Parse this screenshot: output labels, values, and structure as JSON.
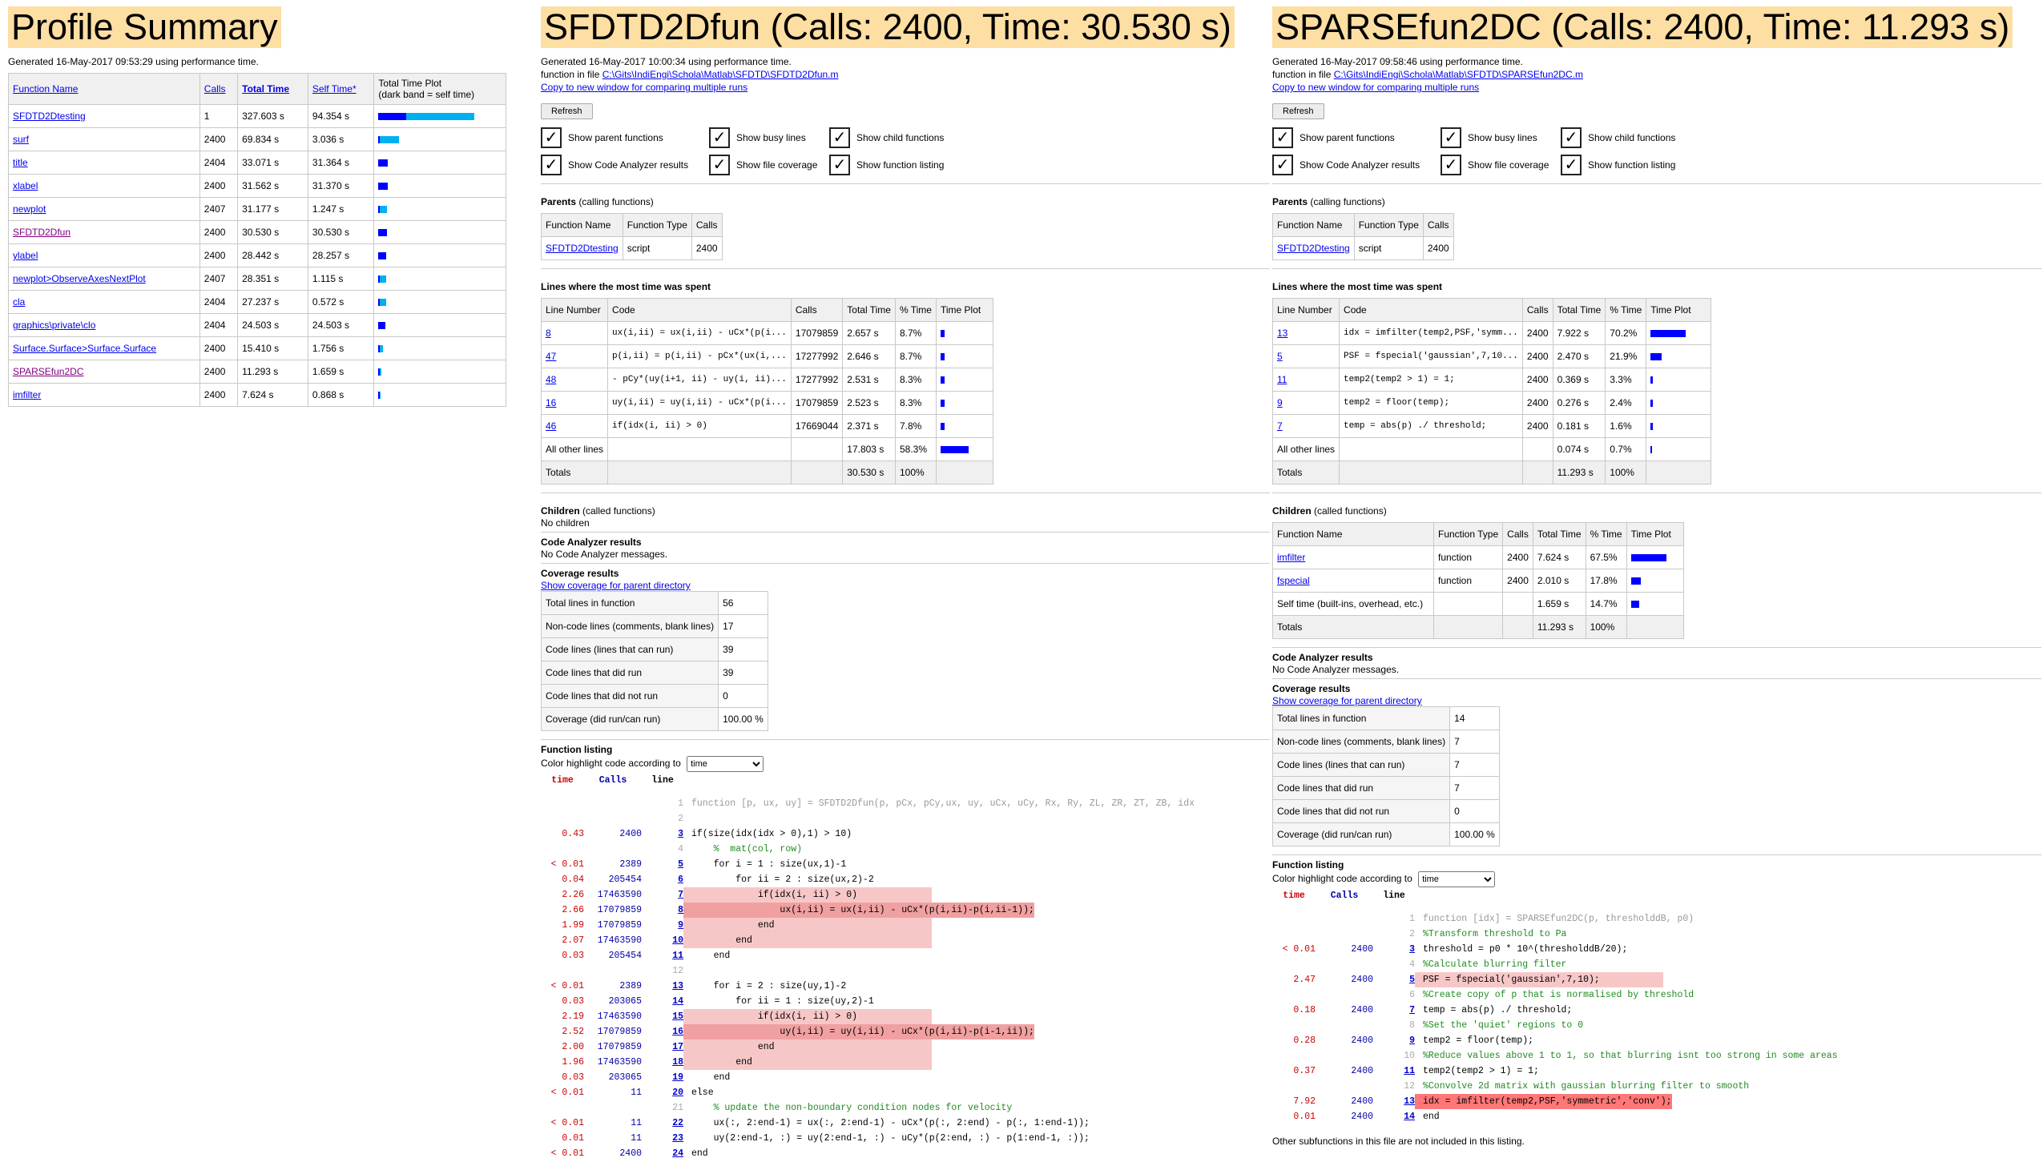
{
  "summary": {
    "title": "Profile Summary",
    "generated": "Generated 16-May-2017 09:53:29 using performance time.",
    "columns": [
      "Function Name",
      "Calls",
      "Total Time",
      "Self Time*",
      "Total Time Plot",
      "(dark band = self time)"
    ],
    "rows": [
      {
        "name": "SFDTD2Dtesting",
        "calls": "1",
        "total": "327.603 s",
        "self": "94.354 s",
        "total_frac": 1.0,
        "self_frac": 0.288,
        "visited": false
      },
      {
        "name": "surf",
        "calls": "2400",
        "total": "69.834 s",
        "self": "3.036 s",
        "total_frac": 0.213,
        "self_frac": 0.009,
        "visited": false
      },
      {
        "name": "title",
        "calls": "2404",
        "total": "33.071 s",
        "self": "31.364 s",
        "total_frac": 0.101,
        "self_frac": 0.096,
        "visited": false
      },
      {
        "name": "xlabel",
        "calls": "2400",
        "total": "31.562 s",
        "self": "31.370 s",
        "total_frac": 0.096,
        "self_frac": 0.096,
        "visited": false
      },
      {
        "name": "newplot",
        "calls": "2407",
        "total": "31.177 s",
        "self": "1.247 s",
        "total_frac": 0.095,
        "self_frac": 0.004,
        "visited": false
      },
      {
        "name": "SFDTD2Dfun",
        "calls": "2400",
        "total": "30.530 s",
        "self": "30.530 s",
        "total_frac": 0.093,
        "self_frac": 0.093,
        "visited": true
      },
      {
        "name": "ylabel",
        "calls": "2400",
        "total": "28.442 s",
        "self": "28.257 s",
        "total_frac": 0.087,
        "self_frac": 0.086,
        "visited": false
      },
      {
        "name": "newplot>ObserveAxesNextPlot",
        "calls": "2407",
        "total": "28.351 s",
        "self": "1.115 s",
        "total_frac": 0.087,
        "self_frac": 0.003,
        "visited": false
      },
      {
        "name": "cla",
        "calls": "2404",
        "total": "27.237 s",
        "self": "0.572 s",
        "total_frac": 0.083,
        "self_frac": 0.002,
        "visited": false
      },
      {
        "name": "graphics\\private\\clo",
        "calls": "2404",
        "total": "24.503 s",
        "self": "24.503 s",
        "total_frac": 0.075,
        "self_frac": 0.075,
        "visited": false
      },
      {
        "name": "Surface.Surface>Surface.Surface",
        "calls": "2400",
        "total": "15.410 s",
        "self": "1.756 s",
        "total_frac": 0.047,
        "self_frac": 0.005,
        "visited": false
      },
      {
        "name": "SPARSEfun2DC",
        "calls": "2400",
        "total": "11.293 s",
        "self": "1.659 s",
        "total_frac": 0.034,
        "self_frac": 0.005,
        "visited": true
      },
      {
        "name": "imfilter",
        "calls": "2400",
        "total": "7.624 s",
        "self": "0.868 s",
        "total_frac": 0.023,
        "self_frac": 0.003,
        "visited": false
      }
    ]
  },
  "common": {
    "refresh": "Refresh",
    "checks": [
      "Show parent functions",
      "Show busy lines",
      "Show child functions",
      "Show Code Analyzer results",
      "Show file coverage",
      "Show function listing"
    ],
    "parents_label": "Parents",
    "parents_sub": "(calling functions)",
    "parents_cols": [
      "Function Name",
      "Function Type",
      "Calls"
    ],
    "lines_label": "Lines where the most time was spent",
    "lines_cols": [
      "Line Number",
      "Code",
      "Calls",
      "Total Time",
      "% Time",
      "Time Plot"
    ],
    "children_label": "Children",
    "children_sub": "(called functions)",
    "ca_label": "Code Analyzer results",
    "ca_msg": "No Code Analyzer messages.",
    "cov_label": "Coverage results",
    "cov_link": "Show coverage for parent directory",
    "cov_rows": [
      "Total lines in function",
      "Non-code lines (comments, blank lines)",
      "Code lines (lines that can run)",
      "Code lines that did run",
      "Code lines that did not run",
      "Coverage (did run/can run)"
    ],
    "listing_label": "Function listing",
    "color_by": "Color highlight code according to",
    "color_opt": "time",
    "lhead": [
      "time",
      "Calls",
      "line"
    ],
    "copy_link": "Copy to new window for comparing multiple runs",
    "fn_in_file": "function in file"
  },
  "fun1": {
    "title": "SFDTD2Dfun (Calls: 2400, Time: 30.530 s)",
    "generated": "Generated 16-May-2017 10:00:34 using performance time.",
    "file": "C:\\Gits\\IndiEngi\\Schola\\Matlab\\SFDTD\\SFDTD2Dfun.m",
    "parents": [
      {
        "name": "SFDTD2Dtesting",
        "type": "script",
        "calls": "2400"
      }
    ],
    "lines": [
      {
        "ln": "8",
        "code": "ux(i,ii) = ux(i,ii) - uCx*(p(i...",
        "calls": "17079859",
        "time": "2.657 s",
        "pct": "8.7%",
        "frac": 0.087
      },
      {
        "ln": "47",
        "code": "p(i,ii) = p(i,ii) - pCx*(ux(i,...",
        "calls": "17277992",
        "time": "2.646 s",
        "pct": "8.7%",
        "frac": 0.087
      },
      {
        "ln": "48",
        "code": "- pCy*(uy(i+1, ii) - uy(i, ii)...",
        "calls": "17277992",
        "time": "2.531 s",
        "pct": "8.3%",
        "frac": 0.083
      },
      {
        "ln": "16",
        "code": "uy(i,ii) = uy(i,ii) - uCx*(p(i...",
        "calls": "17079859",
        "time": "2.523 s",
        "pct": "8.3%",
        "frac": 0.083
      },
      {
        "ln": "46",
        "code": "if(idx(i, ii) > 0)",
        "calls": "17669044",
        "time": "2.371 s",
        "pct": "7.8%",
        "frac": 0.078
      }
    ],
    "other": {
      "label": "All other lines",
      "time": "17.803 s",
      "pct": "58.3%",
      "frac": 0.583
    },
    "totals": {
      "label": "Totals",
      "time": "30.530 s",
      "pct": "100%"
    },
    "no_children": "No children",
    "coverage": [
      "56",
      "17",
      "39",
      "39",
      "0",
      "100.00 %"
    ],
    "listing": [
      {
        "t": "",
        "c": "",
        "ln": "1",
        "code": "function [p, ux, uy] = SFDTD2Dfun(p, pCx, pCy,ux, uy, uCx, uCy, Rx, Ry, ZL, ZR, ZT, ZB, idx",
        "cls": "gray",
        "hl": "",
        "gl": true
      },
      {
        "t": "",
        "c": "",
        "ln": "2",
        "code": "",
        "cls": "",
        "hl": "",
        "gl": true
      },
      {
        "t": "0.43",
        "c": "2400",
        "ln": "3",
        "code": "if(size(idx(idx > 0),1) > 10)",
        "cls": "",
        "hl": "",
        "gl": false
      },
      {
        "t": "",
        "c": "",
        "ln": "4",
        "code": "    %  mat(col, row)",
        "cls": "cmt",
        "hl": "",
        "gl": true
      },
      {
        "t": "< 0.01",
        "c": "2389",
        "ln": "5",
        "code": "    for i = 1 : size(ux,1)-1",
        "cls": "",
        "hl": "",
        "gl": false
      },
      {
        "t": "0.04",
        "c": "205454",
        "ln": "6",
        "code": "        for ii = 2 : size(ux,2)-2",
        "cls": "",
        "hl": "",
        "gl": false
      },
      {
        "t": "2.26",
        "c": "17463590",
        "ln": "7",
        "code": "            if(idx(i, ii) > 0)",
        "cls": "",
        "hl": "hl",
        "gl": false
      },
      {
        "t": "2.66",
        "c": "17079859",
        "ln": "8",
        "code": "                ux(i,ii) = ux(i,ii) - uCx*(p(i,ii)-p(i,ii-1));",
        "cls": "",
        "hl": "hl2",
        "gl": false
      },
      {
        "t": "1.99",
        "c": "17079859",
        "ln": "9",
        "code": "            end",
        "cls": "",
        "hl": "hl",
        "gl": false
      },
      {
        "t": "2.07",
        "c": "17463590",
        "ln": "10",
        "code": "        end",
        "cls": "",
        "hl": "hl",
        "gl": false
      },
      {
        "t": "0.03",
        "c": "205454",
        "ln": "11",
        "code": "    end",
        "cls": "",
        "hl": "",
        "gl": false
      },
      {
        "t": "",
        "c": "",
        "ln": "12",
        "code": "",
        "cls": "",
        "hl": "",
        "gl": true
      },
      {
        "t": "< 0.01",
        "c": "2389",
        "ln": "13",
        "code": "    for i = 2 : size(uy,1)-2",
        "cls": "",
        "hl": "",
        "gl": false
      },
      {
        "t": "0.03",
        "c": "203065",
        "ln": "14",
        "code": "        for ii = 1 : size(uy,2)-1",
        "cls": "",
        "hl": "",
        "gl": false
      },
      {
        "t": "2.19",
        "c": "17463590",
        "ln": "15",
        "code": "            if(idx(i, ii) > 0)",
        "cls": "",
        "hl": "hl",
        "gl": false
      },
      {
        "t": "2.52",
        "c": "17079859",
        "ln": "16",
        "code": "                uy(i,ii) = uy(i,ii) - uCx*(p(i,ii)-p(i-1,ii));",
        "cls": "",
        "hl": "hl2",
        "gl": false
      },
      {
        "t": "2.00",
        "c": "17079859",
        "ln": "17",
        "code": "            end",
        "cls": "",
        "hl": "hl",
        "gl": false
      },
      {
        "t": "1.96",
        "c": "17463590",
        "ln": "18",
        "code": "        end",
        "cls": "",
        "hl": "hl",
        "gl": false
      },
      {
        "t": "0.03",
        "c": "203065",
        "ln": "19",
        "code": "    end",
        "cls": "",
        "hl": "",
        "gl": false
      },
      {
        "t": "< 0.01",
        "c": "11",
        "ln": "20",
        "code": "else",
        "cls": "",
        "hl": "",
        "gl": false
      },
      {
        "t": "",
        "c": "",
        "ln": "21",
        "code": "    % update the non-boundary condition nodes for velocity",
        "cls": "cmt",
        "hl": "",
        "gl": true
      },
      {
        "t": "< 0.01",
        "c": "11",
        "ln": "22",
        "code": "    ux(:, 2:end-1) = ux(:, 2:end-1) - uCx*(p(:, 2:end) - p(:, 1:end-1));",
        "cls": "",
        "hl": "",
        "gl": false
      },
      {
        "t": "0.01",
        "c": "11",
        "ln": "23",
        "code": "    uy(2:end-1, :) = uy(2:end-1, :) - uCy*(p(2:end, :) - p(1:end-1, :));",
        "cls": "",
        "hl": "",
        "gl": false
      },
      {
        "t": "< 0.01",
        "c": "2400",
        "ln": "24",
        "code": "end",
        "cls": "",
        "hl": "",
        "gl": false
      },
      {
        "t": "",
        "c": "",
        "ln": "25",
        "code": "",
        "cls": "",
        "hl": "",
        "gl": true
      }
    ]
  },
  "fun2": {
    "title": "SPARSEfun2DC (Calls: 2400, Time: 11.293 s)",
    "generated": "Generated 16-May-2017 09:58:46 using performance time.",
    "file": "C:\\Gits\\IndiEngi\\Schola\\Matlab\\SFDTD\\SPARSEfun2DC.m",
    "parents": [
      {
        "name": "SFDTD2Dtesting",
        "type": "script",
        "calls": "2400"
      }
    ],
    "lines": [
      {
        "ln": "13",
        "code": "idx = imfilter(temp2,PSF,'symm...",
        "calls": "2400",
        "time": "7.922 s",
        "pct": "70.2%",
        "frac": 0.702
      },
      {
        "ln": "5",
        "code": "PSF = fspecial('gaussian',7,10...",
        "calls": "2400",
        "time": "2.470 s",
        "pct": "21.9%",
        "frac": 0.219
      },
      {
        "ln": "11",
        "code": "temp2(temp2 > 1) = 1;",
        "calls": "2400",
        "time": "0.369 s",
        "pct": "3.3%",
        "frac": 0.033
      },
      {
        "ln": "9",
        "code": "temp2 = floor(temp);",
        "calls": "2400",
        "time": "0.276 s",
        "pct": "2.4%",
        "frac": 0.024
      },
      {
        "ln": "7",
        "code": "temp = abs(p) ./ threshold;",
        "calls": "2400",
        "time": "0.181 s",
        "pct": "1.6%",
        "frac": 0.016
      }
    ],
    "other": {
      "label": "All other lines",
      "time": "0.074 s",
      "pct": "0.7%",
      "frac": 0.007
    },
    "totals": {
      "label": "Totals",
      "time": "11.293 s",
      "pct": "100%"
    },
    "children_cols": [
      "Function Name",
      "Function Type",
      "Calls",
      "Total Time",
      "% Time",
      "Time Plot"
    ],
    "children": [
      {
        "name": "imfilter",
        "type": "function",
        "calls": "2400",
        "time": "7.624 s",
        "pct": "67.5%",
        "frac": 0.675,
        "link": true
      },
      {
        "name": "fspecial",
        "type": "function",
        "calls": "2400",
        "time": "2.010 s",
        "pct": "17.8%",
        "frac": 0.178,
        "link": true
      },
      {
        "name": "Self time (built-ins, overhead, etc.)",
        "type": "",
        "calls": "",
        "time": "1.659 s",
        "pct": "14.7%",
        "frac": 0.147,
        "link": false
      },
      {
        "name": "Totals",
        "type": "",
        "calls": "",
        "time": "11.293 s",
        "pct": "100%",
        "frac": 0,
        "link": false
      }
    ],
    "coverage": [
      "14",
      "7",
      "7",
      "7",
      "0",
      "100.00 %"
    ],
    "listing": [
      {
        "t": "",
        "c": "",
        "ln": "1",
        "code": "function [idx] = SPARSEfun2DC(p, thresholddB, p0)",
        "cls": "gray",
        "hl": "",
        "gl": true
      },
      {
        "t": "",
        "c": "",
        "ln": "2",
        "code": "%Transform threshold to Pa",
        "cls": "cmt",
        "hl": "",
        "gl": true
      },
      {
        "t": "< 0.01",
        "c": "2400",
        "ln": "3",
        "code": "threshold = p0 * 10^(thresholddB/20);",
        "cls": "",
        "hl": "",
        "gl": false
      },
      {
        "t": "",
        "c": "",
        "ln": "4",
        "code": "%Calculate blurring filter",
        "cls": "cmt",
        "hl": "",
        "gl": true
      },
      {
        "t": "2.47",
        "c": "2400",
        "ln": "5",
        "code": "PSF = fspecial('gaussian',7,10);",
        "cls": "",
        "hl": "hl",
        "gl": false
      },
      {
        "t": "",
        "c": "",
        "ln": "6",
        "code": "%Create copy of p that is normalised by threshold",
        "cls": "cmt",
        "hl": "",
        "gl": true
      },
      {
        "t": "0.18",
        "c": "2400",
        "ln": "7",
        "code": "temp = abs(p) ./ threshold;",
        "cls": "",
        "hl": "",
        "gl": false
      },
      {
        "t": "",
        "c": "",
        "ln": "8",
        "code": "%Set the 'quiet' regions to 0",
        "cls": "cmt",
        "hl": "",
        "gl": true
      },
      {
        "t": "0.28",
        "c": "2400",
        "ln": "9",
        "code": "temp2 = floor(temp);",
        "cls": "",
        "hl": "",
        "gl": false
      },
      {
        "t": "",
        "c": "",
        "ln": "10",
        "code": "%Reduce values above 1 to 1, so that blurring isnt too strong in some areas",
        "cls": "cmt",
        "hl": "",
        "gl": true
      },
      {
        "t": "0.37",
        "c": "2400",
        "ln": "11",
        "code": "temp2(temp2 > 1) = 1;",
        "cls": "",
        "hl": "",
        "gl": false
      },
      {
        "t": "",
        "c": "",
        "ln": "12",
        "code": "%Convolve 2d matrix with gaussian blurring filter to smooth",
        "cls": "cmt",
        "hl": "",
        "gl": true
      },
      {
        "t": "7.92",
        "c": "2400",
        "ln": "13",
        "code": "idx = imfilter(temp2,PSF,'symmetric','conv');",
        "cls": "",
        "hl": "hl3",
        "gl": false
      },
      {
        "t": "0.01",
        "c": "2400",
        "ln": "14",
        "code": "end",
        "cls": "",
        "hl": "",
        "gl": false
      }
    ],
    "footer": "Other subfunctions in this file are not included in this listing."
  },
  "colors": {
    "dark_bar": "#0000ff",
    "light_bar": "#00b0f0",
    "title_bg": "#fddea3",
    "hl_light": "#f7c7c7",
    "hl_dark": "#ff7777"
  }
}
